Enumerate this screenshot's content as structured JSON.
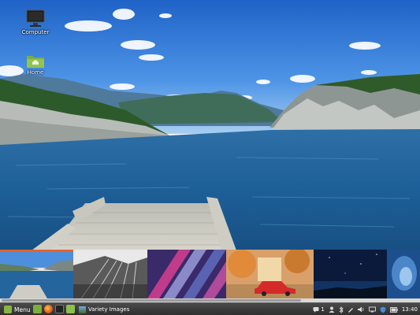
{
  "desktop": {
    "icons": [
      {
        "label": "Computer",
        "icon": "computer-icon"
      },
      {
        "label": "Home",
        "icon": "home-folder-icon"
      }
    ],
    "wallpaper": "lake-pier-landscape"
  },
  "variety_strip": {
    "thumbnails": [
      {
        "name": "lake-pier",
        "selected": true
      },
      {
        "name": "skyscraper-bw",
        "selected": false
      },
      {
        "name": "abstract-streaks",
        "selected": false
      },
      {
        "name": "red-car-autumn",
        "selected": false
      },
      {
        "name": "night-sky",
        "selected": false
      },
      {
        "name": "blue-water",
        "selected": false
      }
    ]
  },
  "panel": {
    "menu_label": "Menu",
    "launchers": [
      "files-icon",
      "firefox-icon",
      "terminal-icon",
      "folder-icon"
    ],
    "windows": [
      {
        "label": "Variety Images",
        "icon": "variety-icon"
      }
    ],
    "tray": {
      "notification_count": "1",
      "clock": "13:40",
      "icons": [
        "chat-icon",
        "user-icon",
        "bluetooth-icon",
        "pen-icon",
        "volume-icon",
        "network-icon",
        "shield-icon",
        "battery-icon"
      ]
    }
  },
  "colors": {
    "panel_bg": "#3a3a3a",
    "mint_green": "#87b545",
    "selected_thumb": "#e8622a"
  }
}
